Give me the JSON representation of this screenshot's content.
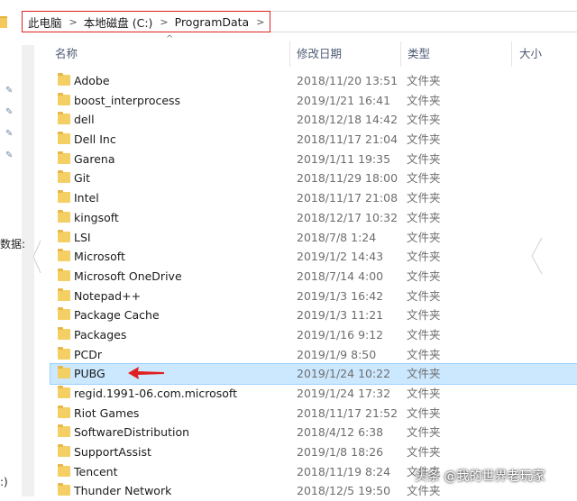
{
  "address_bar": {
    "crumbs": [
      "此电脑",
      "本地磁盘 (C:)",
      "ProgramData"
    ],
    "separator": ">"
  },
  "nav": {
    "partial_label": "数据:",
    "bottom_label": ":)"
  },
  "columns": {
    "name": "名称",
    "date": "修改日期",
    "type": "类型",
    "size": "大小"
  },
  "files": [
    {
      "name": "Adobe",
      "date": "2018/11/20 13:51",
      "type": "文件夹"
    },
    {
      "name": "boost_interprocess",
      "date": "2019/1/21 16:41",
      "type": "文件夹"
    },
    {
      "name": "dell",
      "date": "2018/12/18 14:42",
      "type": "文件夹"
    },
    {
      "name": "Dell Inc",
      "date": "2018/11/17 21:04",
      "type": "文件夹"
    },
    {
      "name": "Garena",
      "date": "2019/1/11 19:35",
      "type": "文件夹"
    },
    {
      "name": "Git",
      "date": "2018/11/29 18:00",
      "type": "文件夹"
    },
    {
      "name": "Intel",
      "date": "2018/11/17 21:08",
      "type": "文件夹"
    },
    {
      "name": "kingsoft",
      "date": "2018/12/17 10:32",
      "type": "文件夹"
    },
    {
      "name": "LSI",
      "date": "2018/7/8 1:24",
      "type": "文件夹"
    },
    {
      "name": "Microsoft",
      "date": "2019/1/2 14:43",
      "type": "文件夹"
    },
    {
      "name": "Microsoft OneDrive",
      "date": "2018/7/14 4:00",
      "type": "文件夹"
    },
    {
      "name": "Notepad++",
      "date": "2019/1/3 16:42",
      "type": "文件夹"
    },
    {
      "name": "Package Cache",
      "date": "2019/1/3 11:21",
      "type": "文件夹"
    },
    {
      "name": "Packages",
      "date": "2019/1/16 9:12",
      "type": "文件夹"
    },
    {
      "name": "PCDr",
      "date": "2019/1/9 8:50",
      "type": "文件夹"
    },
    {
      "name": "PUBG",
      "date": "2019/1/24 10:22",
      "type": "文件夹",
      "selected": true
    },
    {
      "name": "regid.1991-06.com.microsoft",
      "date": "2019/1/24 17:32",
      "type": "文件夹"
    },
    {
      "name": "Riot Games",
      "date": "2018/11/17 21:52",
      "type": "文件夹"
    },
    {
      "name": "SoftwareDistribution",
      "date": "2018/4/12 6:38",
      "type": "文件夹"
    },
    {
      "name": "SupportAssist",
      "date": "2019/1/8 18:26",
      "type": "文件夹"
    },
    {
      "name": "Tencent",
      "date": "2018/11/19 8:24",
      "type": "文件夹"
    },
    {
      "name": "Thunder Network",
      "date": "2018/12/5 19:50",
      "type": "文件夹"
    }
  ],
  "watermark": "头条 @我的世界老玩家",
  "colors": {
    "selection": "#cce8ff",
    "highlight_box": "#e02020",
    "folder": "#f4cf64",
    "arrow": "#e02020"
  }
}
